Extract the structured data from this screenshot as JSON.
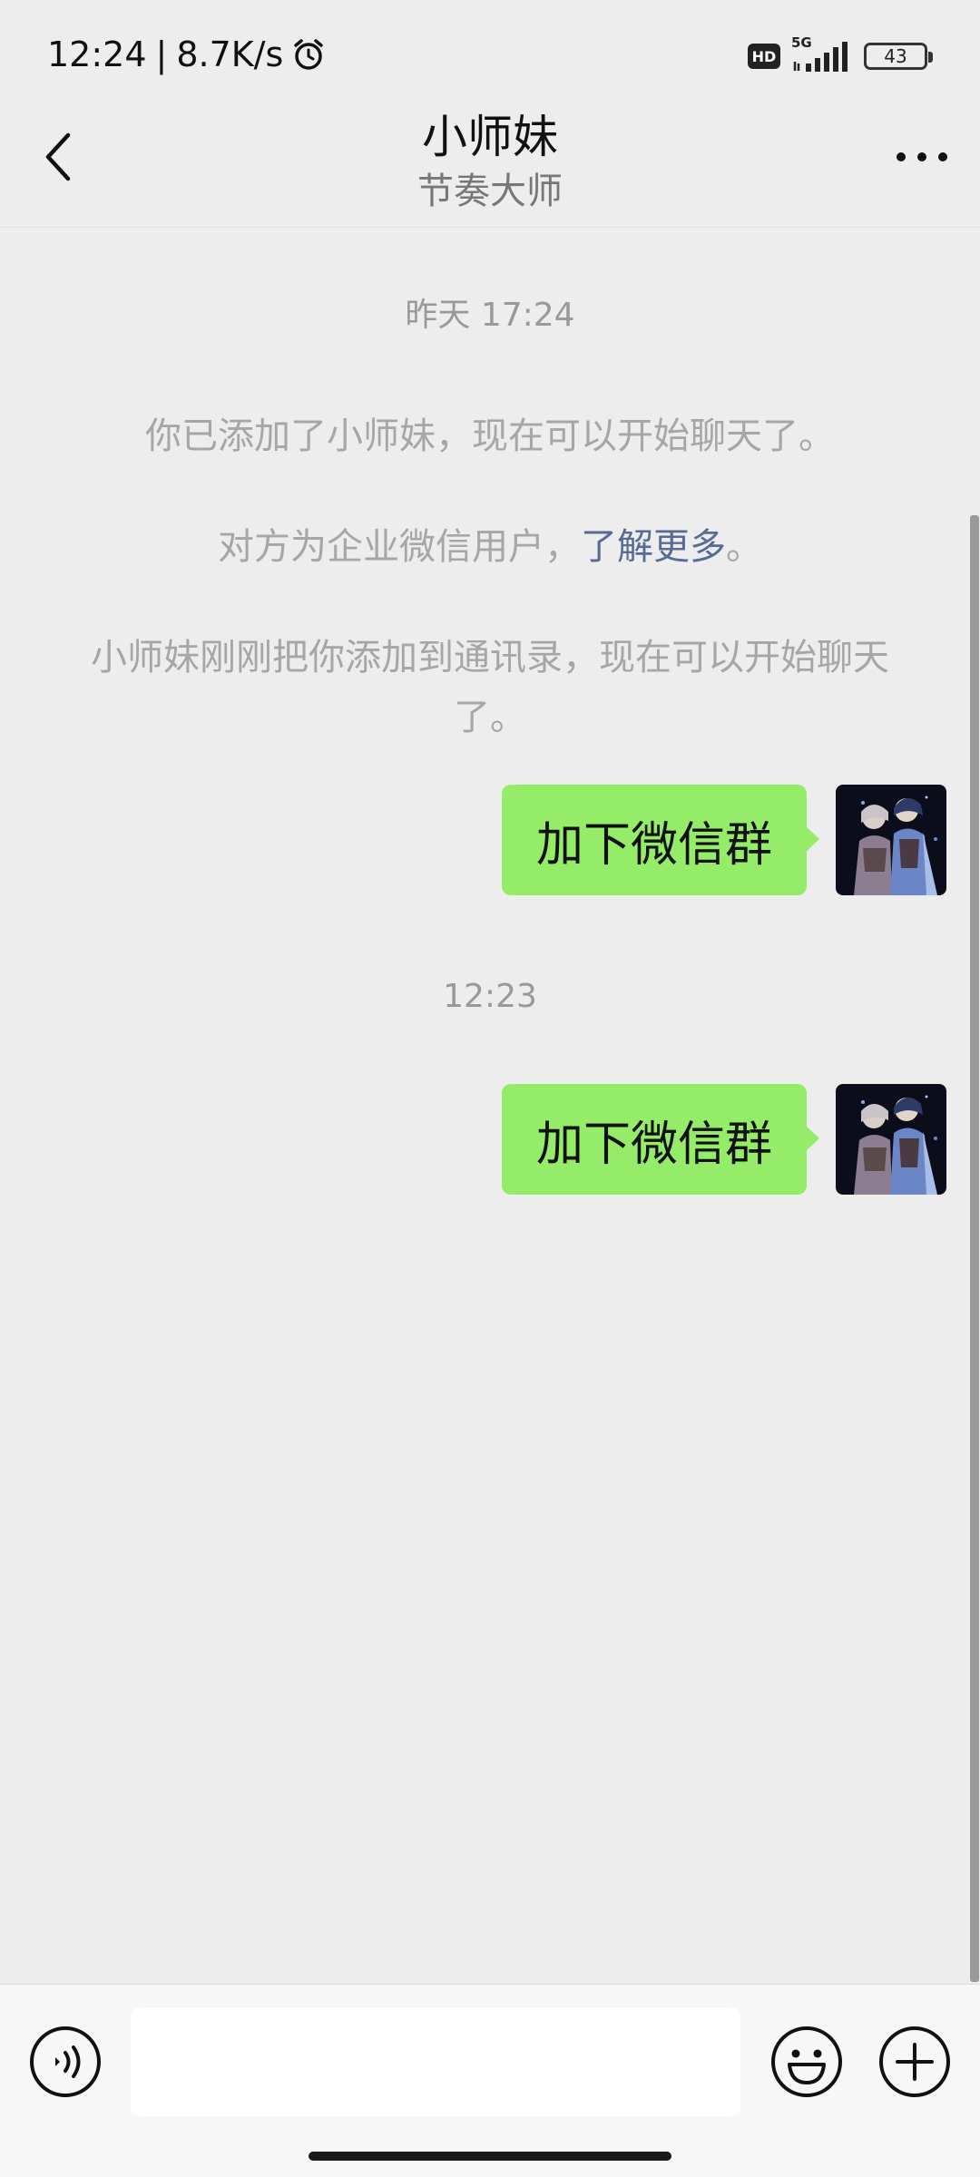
{
  "status_bar": {
    "time": "12:24",
    "separator": "|",
    "net_speed": "8.7K/s",
    "hd_label": "HD",
    "network_label": "5G",
    "battery": "43",
    "alarm_icon": "alarm-clock-icon",
    "signal_icon": "signal-bars-icon"
  },
  "header": {
    "title": "小师妹",
    "subtitle": "节奏大师",
    "back_icon": "chevron-left-icon",
    "more_icon": "more-dots-icon"
  },
  "chat": {
    "timestamp_1": "昨天 17:24",
    "system_1": "你已添加了小师妹，现在可以开始聊天了。",
    "system_2_text": "对方为企业微信用户，",
    "system_2_link": "了解更多",
    "system_2_end": "。",
    "system_3": "小师妹刚刚把你添加到通讯录，现在可以开始聊天了。",
    "message_1": "加下微信群",
    "timestamp_2": "12:23",
    "message_2": "加下微信群"
  },
  "bottom_bar": {
    "input_value": "",
    "voice_icon": "voice-icon",
    "emoji_icon": "emoji-smile-icon",
    "plus_icon": "plus-circle-icon"
  },
  "colors": {
    "background": "#EDEDED",
    "bubble": "#95EC69",
    "link": "#576B95",
    "system_text": "#A6A6A6"
  }
}
